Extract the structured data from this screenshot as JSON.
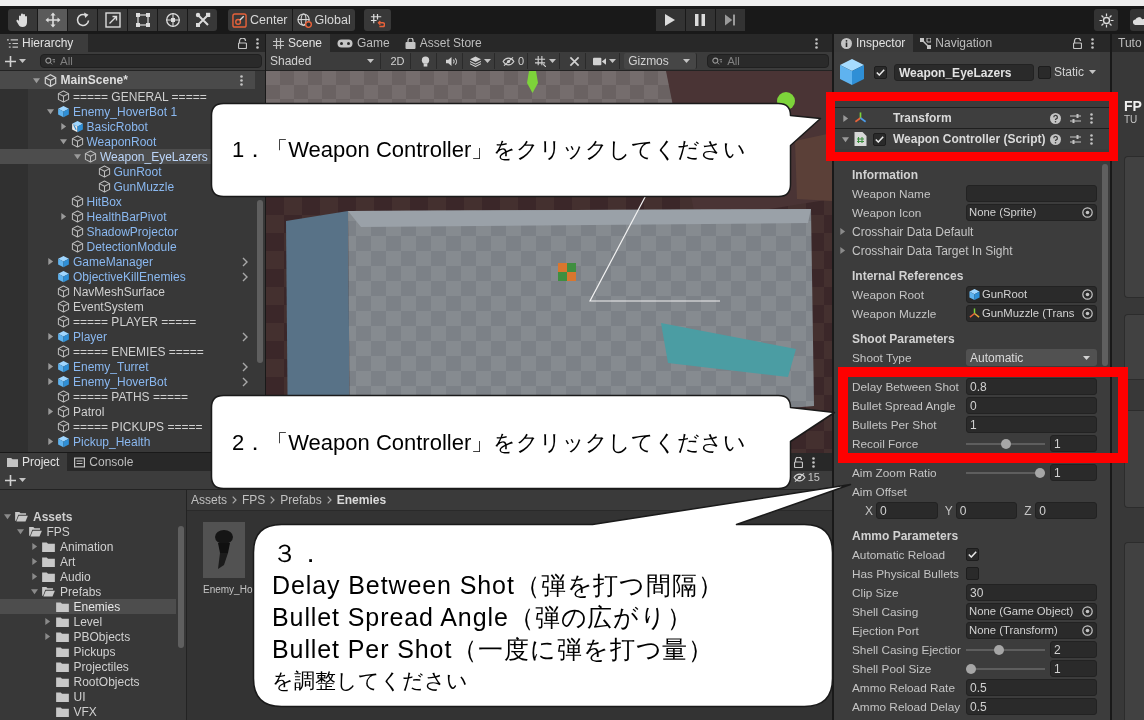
{
  "toolbar": {
    "tools": [
      {
        "kind": "hand",
        "selected": false
      },
      {
        "kind": "move",
        "selected": true
      },
      {
        "kind": "rotate",
        "selected": false
      },
      {
        "kind": "scale",
        "selected": false
      },
      {
        "kind": "rect",
        "selected": false
      },
      {
        "kind": "transform",
        "selected": false
      },
      {
        "kind": "custom",
        "selected": false
      }
    ],
    "pivot": [
      {
        "label": "Center"
      },
      {
        "label": "Global"
      }
    ]
  },
  "hierarchy": {
    "tab": "Hierarchy",
    "search_placeholder": "All",
    "scene": {
      "name": "MainScene*",
      "expanded": true,
      "children": [
        {
          "name": "===== GENERAL =====",
          "kind": "object",
          "in_prefab": false,
          "selected": false,
          "open_prefab": false
        },
        {
          "name": "Enemy_HoverBot 1",
          "kind": "prefab",
          "in_prefab": true,
          "selected": false,
          "expanded": true,
          "open_prefab": false,
          "children": [
            {
              "name": "BasicRobot",
              "kind": "model",
              "in_prefab": true,
              "selected": false,
              "expanded": false
            },
            {
              "name": "WeaponRoot",
              "kind": "object",
              "in_prefab": true,
              "selected": false,
              "expanded": true,
              "children": [
                {
                  "name": "Weapon_EyeLazers",
                  "kind": "object",
                  "in_prefab": true,
                  "selected": true,
                  "expanded": true,
                  "children": [
                    {
                      "name": "GunRoot",
                      "kind": "object",
                      "in_prefab": true,
                      "selected": false
                    },
                    {
                      "name": "GunMuzzle",
                      "kind": "object",
                      "in_prefab": true,
                      "selected": false
                    }
                  ]
                }
              ]
            },
            {
              "name": "HitBox",
              "kind": "object",
              "in_prefab": true,
              "selected": false
            },
            {
              "name": "HealthBarPivot",
              "kind": "object",
              "in_prefab": true,
              "selected": false,
              "expanded": false
            },
            {
              "name": "ShadowProjector",
              "kind": "object",
              "in_prefab": true,
              "selected": false
            },
            {
              "name": "DetectionModule",
              "kind": "object",
              "in_prefab": true,
              "selected": false
            }
          ]
        },
        {
          "name": "GameManager",
          "kind": "prefab",
          "in_prefab": true,
          "selected": false,
          "expanded": false,
          "open_prefab": true
        },
        {
          "name": "ObjectiveKillEnemies",
          "kind": "prefab",
          "in_prefab": true,
          "selected": false,
          "open_prefab": true
        },
        {
          "name": "NavMeshSurface",
          "kind": "object",
          "in_prefab": false,
          "selected": false,
          "open_prefab": false
        },
        {
          "name": "EventSystem",
          "kind": "object",
          "in_prefab": false,
          "selected": false,
          "open_prefab": false
        },
        {
          "name": "===== PLAYER =====",
          "kind": "object",
          "in_prefab": false,
          "selected": false,
          "open_prefab": false
        },
        {
          "name": "Player",
          "kind": "prefab",
          "in_prefab": true,
          "selected": false,
          "expanded": false,
          "open_prefab": true
        },
        {
          "name": "===== ENEMIES =====",
          "kind": "object",
          "in_prefab": false,
          "selected": false,
          "open_prefab": false
        },
        {
          "name": "Enemy_Turret",
          "kind": "prefab",
          "in_prefab": true,
          "selected": false,
          "expanded": false,
          "open_prefab": true
        },
        {
          "name": "Enemy_HoverBot",
          "kind": "prefab",
          "in_prefab": true,
          "selected": false,
          "expanded": false,
          "open_prefab": true
        },
        {
          "name": "===== PATHS =====",
          "kind": "object",
          "in_prefab": false,
          "selected": false,
          "open_prefab": false
        },
        {
          "name": "Patrol",
          "kind": "object",
          "in_prefab": false,
          "selected": false,
          "expanded": false,
          "open_prefab": false
        },
        {
          "name": "===== PICKUPS =====",
          "kind": "object",
          "in_prefab": false,
          "selected": false,
          "open_prefab": false
        },
        {
          "name": "Pickup_Health",
          "kind": "prefab",
          "in_prefab": true,
          "selected": false,
          "expanded": false,
          "open_prefab": false
        }
      ]
    }
  },
  "scene": {
    "tabs": [
      {
        "label": "Scene",
        "selected": true
      },
      {
        "label": "Game",
        "selected": false
      },
      {
        "label": "Asset Store",
        "selected": false
      }
    ],
    "shading": "Shaded",
    "view_2d": "2D",
    "hidden_count": "0",
    "gizmos": "Gizmos",
    "search_placeholder": "All"
  },
  "project": {
    "tabs": [
      {
        "label": "Project",
        "selected": true
      },
      {
        "label": "Console",
        "selected": false
      }
    ],
    "hidden_count": "15",
    "tree": [
      {
        "name": "Assets",
        "expanded": true,
        "selected": false,
        "children": [
          {
            "name": "FPS",
            "expanded": true,
            "selected": false,
            "children": [
              {
                "name": "Animation",
                "expanded": false,
                "selected": false
              },
              {
                "name": "Art",
                "expanded": false,
                "selected": false
              },
              {
                "name": "Audio",
                "expanded": false,
                "selected": false
              },
              {
                "name": "Prefabs",
                "expanded": true,
                "selected": false,
                "children": [
                  {
                    "name": "Enemies",
                    "selected": true
                  },
                  {
                    "name": "Level",
                    "expanded": false,
                    "selected": false
                  },
                  {
                    "name": "PBObjects",
                    "expanded": false,
                    "selected": false
                  },
                  {
                    "name": "Pickups",
                    "selected": false
                  },
                  {
                    "name": "Projectiles",
                    "selected": false
                  },
                  {
                    "name": "RootObjects",
                    "selected": false
                  },
                  {
                    "name": "UI",
                    "selected": false
                  },
                  {
                    "name": "VFX",
                    "selected": false
                  }
                ]
              }
            ]
          }
        ]
      }
    ],
    "breadcrumb": [
      "Assets",
      "FPS",
      "Prefabs",
      "Enemies"
    ],
    "assets": [
      {
        "name": "Enemy_Ho"
      }
    ]
  },
  "inspector": {
    "tabs": [
      {
        "label": "Inspector",
        "selected": true
      },
      {
        "label": "Navigation",
        "selected": false
      }
    ],
    "object": {
      "active": true,
      "name": "Weapon_EyeLazers",
      "static": false,
      "static_label": "Static"
    },
    "components": [
      {
        "name": "Transform",
        "kind": "transform",
        "expanded": false,
        "highlight": true
      },
      {
        "name": "Weapon Controller (Script)",
        "kind": "script",
        "expanded": true,
        "enabled": true,
        "highlight": true
      }
    ],
    "sections": [
      {
        "title": "Information",
        "rows": [
          {
            "label": "Weapon Name",
            "kind": "text"
          },
          {
            "label": "Weapon Icon",
            "kind": "object",
            "value": "None (Sprite)"
          },
          {
            "label": "Crosshair Data Default",
            "kind": "foldout",
            "expanded": false
          },
          {
            "label": "Crosshair Data Target In Sight",
            "kind": "foldout",
            "expanded": false
          }
        ]
      },
      {
        "title": "Internal References",
        "rows": [
          {
            "label": "Weapon Root",
            "kind": "object",
            "value": "GunRoot",
            "ref": {
              "kind": "gameobject"
            }
          },
          {
            "label": "Weapon Muzzle",
            "kind": "object",
            "value": "GunMuzzle (Trans",
            "ref": {
              "kind": "transform"
            }
          }
        ]
      },
      {
        "title": "Shoot Parameters",
        "rows": [
          {
            "label": "Shoot Type",
            "kind": "dropdown",
            "value": "Automatic",
            "highlight": false
          },
          {
            "label": "Delay Between Shot",
            "kind": "text",
            "value": "0.8",
            "highlight": true
          },
          {
            "label": "Bullet Spread Angle",
            "kind": "text",
            "value": "0",
            "highlight": true
          },
          {
            "label": "Bullets Per Shot",
            "kind": "text",
            "value": "1",
            "highlight": true
          },
          {
            "label": "Recoil Force",
            "kind": "slider",
            "level": 0.5,
            "value": "1",
            "highlight": true
          },
          {
            "label": "Aim Zoom Ratio",
            "kind": "slider",
            "level": 1,
            "value": "1",
            "highlight": false
          },
          {
            "label": "Aim Offset",
            "kind": "vector",
            "axes": [
              {
                "label": "X",
                "value": "0"
              },
              {
                "label": "Y",
                "value": "0"
              },
              {
                "label": "Z",
                "value": "0"
              }
            ],
            "highlight": false
          }
        ]
      },
      {
        "title": "Ammo Parameters",
        "rows": [
          {
            "label": "Automatic Reload",
            "kind": "checkbox",
            "checked": true
          },
          {
            "label": "Has Physical Bullets",
            "kind": "checkbox",
            "checked": false
          },
          {
            "label": "Clip Size",
            "kind": "text",
            "value": "30"
          },
          {
            "label": "Shell Casing",
            "kind": "object",
            "value": "None (Game Object)"
          },
          {
            "label": "Ejection Port",
            "kind": "object",
            "value": "None (Transform)"
          },
          {
            "label": "Shell Casing Ejectior",
            "kind": "slider",
            "level": 0.4,
            "value": "2"
          },
          {
            "label": "Shell Pool Size",
            "kind": "slider",
            "level": 0,
            "value": "1"
          },
          {
            "label": "Ammo Reload Rate",
            "kind": "text",
            "value": "0.5"
          },
          {
            "label": "Ammo Reload Delay",
            "kind": "text",
            "value": "0.5"
          }
        ]
      }
    ]
  },
  "tutorials": {
    "tab": "Tuto",
    "title": "FP",
    "subtitle": "TU"
  },
  "callouts": [
    {
      "text": "1．「Weapon Controller」をクリックしてください"
    },
    {
      "text": "2．「Weapon Controller」をクリックしてください"
    },
    {
      "lines": [
        "３．",
        "Delay Between Shot（弾を打つ間隔）",
        "Bullet Spread Angle（弾の広がり）",
        "Bullet Per Shot（一度に弾を打つ量）",
        "を調整してください"
      ]
    }
  ]
}
